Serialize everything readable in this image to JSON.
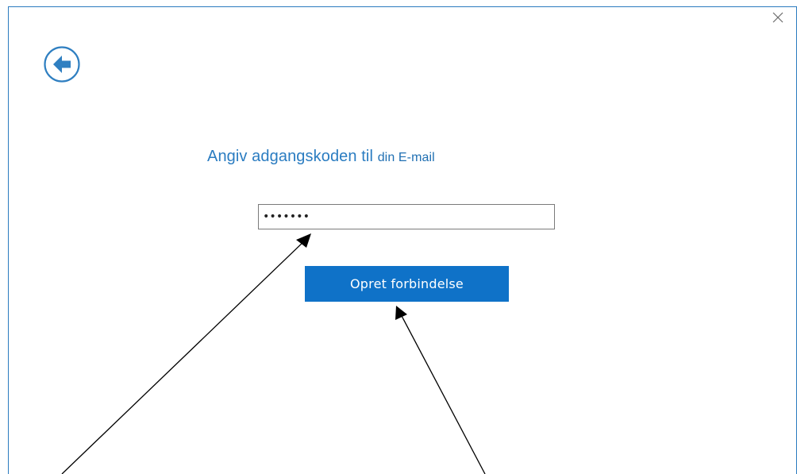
{
  "dialog": {
    "close_icon": "close-icon",
    "back_icon": "back-arrow-icon",
    "heading_prefix": "Angiv adgangskoden til ",
    "heading_account": "din E-mail",
    "password": {
      "masked_value": "•••••••",
      "type": "password"
    },
    "connect_label": "Opret forbindelse"
  },
  "colors": {
    "accent": "#0f72c8",
    "heading": "#2a7cc1",
    "frame": "#2b7bbf"
  },
  "annotations": {
    "arrows": [
      "arrow-to-password-field",
      "arrow-to-connect-button"
    ]
  }
}
